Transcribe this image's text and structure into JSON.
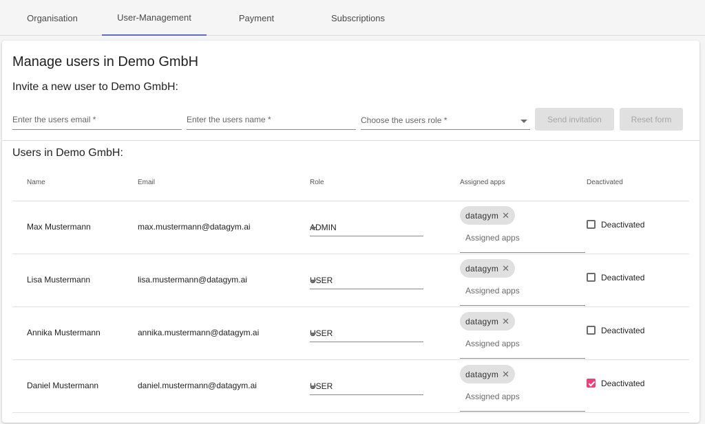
{
  "tabs": [
    {
      "label": "Organisation"
    },
    {
      "label": "User-Management"
    },
    {
      "label": "Payment"
    },
    {
      "label": "Subscriptions"
    }
  ],
  "active_tab": "User-Management",
  "page": {
    "title": "Manage users in Demo GmbH",
    "invite_title": "Invite a new user to Demo GmbH:",
    "users_title": "Users in Demo GmbH:"
  },
  "invite_form": {
    "email_placeholder": "Enter the users email *",
    "name_placeholder": "Enter the users name *",
    "role_placeholder": "Choose the users role *",
    "send_label": "Send invitation",
    "reset_label": "Reset form"
  },
  "table": {
    "headers": [
      "Name",
      "Email",
      "Role",
      "Assigned apps",
      "Deactivated"
    ],
    "rows": [
      {
        "name": "Max Mustermann",
        "email": "max.mustermann@datagym.ai",
        "role": "ADMIN",
        "app": "datagym",
        "apps_placeholder": "Assigned apps",
        "deactivated_label": "Deactivated",
        "deactivated": false
      },
      {
        "name": "Lisa Mustermann",
        "email": "lisa.mustermann@datagym.ai",
        "role": "USER",
        "app": "datagym",
        "apps_placeholder": "Assigned apps",
        "deactivated_label": "Deactivated",
        "deactivated": false
      },
      {
        "name": "Annika Mustermann",
        "email": "annika.mustermann@datagym.ai",
        "role": "USER",
        "app": "datagym",
        "apps_placeholder": "Assigned apps",
        "deactivated_label": "Deactivated",
        "deactivated": false
      },
      {
        "name": "Daniel Mustermann",
        "email": "daniel.mustermann@datagym.ai",
        "role": "USER",
        "app": "datagym",
        "apps_placeholder": "Assigned apps",
        "deactivated_label": "Deactivated",
        "deactivated": true
      }
    ]
  },
  "icons": {
    "chip_remove": "close-icon",
    "dropdown": "caret-down-icon",
    "checkbox": "checkbox-icon"
  },
  "colors": {
    "active_tab_indicator": "#5c6bc0",
    "checkbox_checked": "#ec407a",
    "disabled_button_bg": "#e0e0e0"
  }
}
